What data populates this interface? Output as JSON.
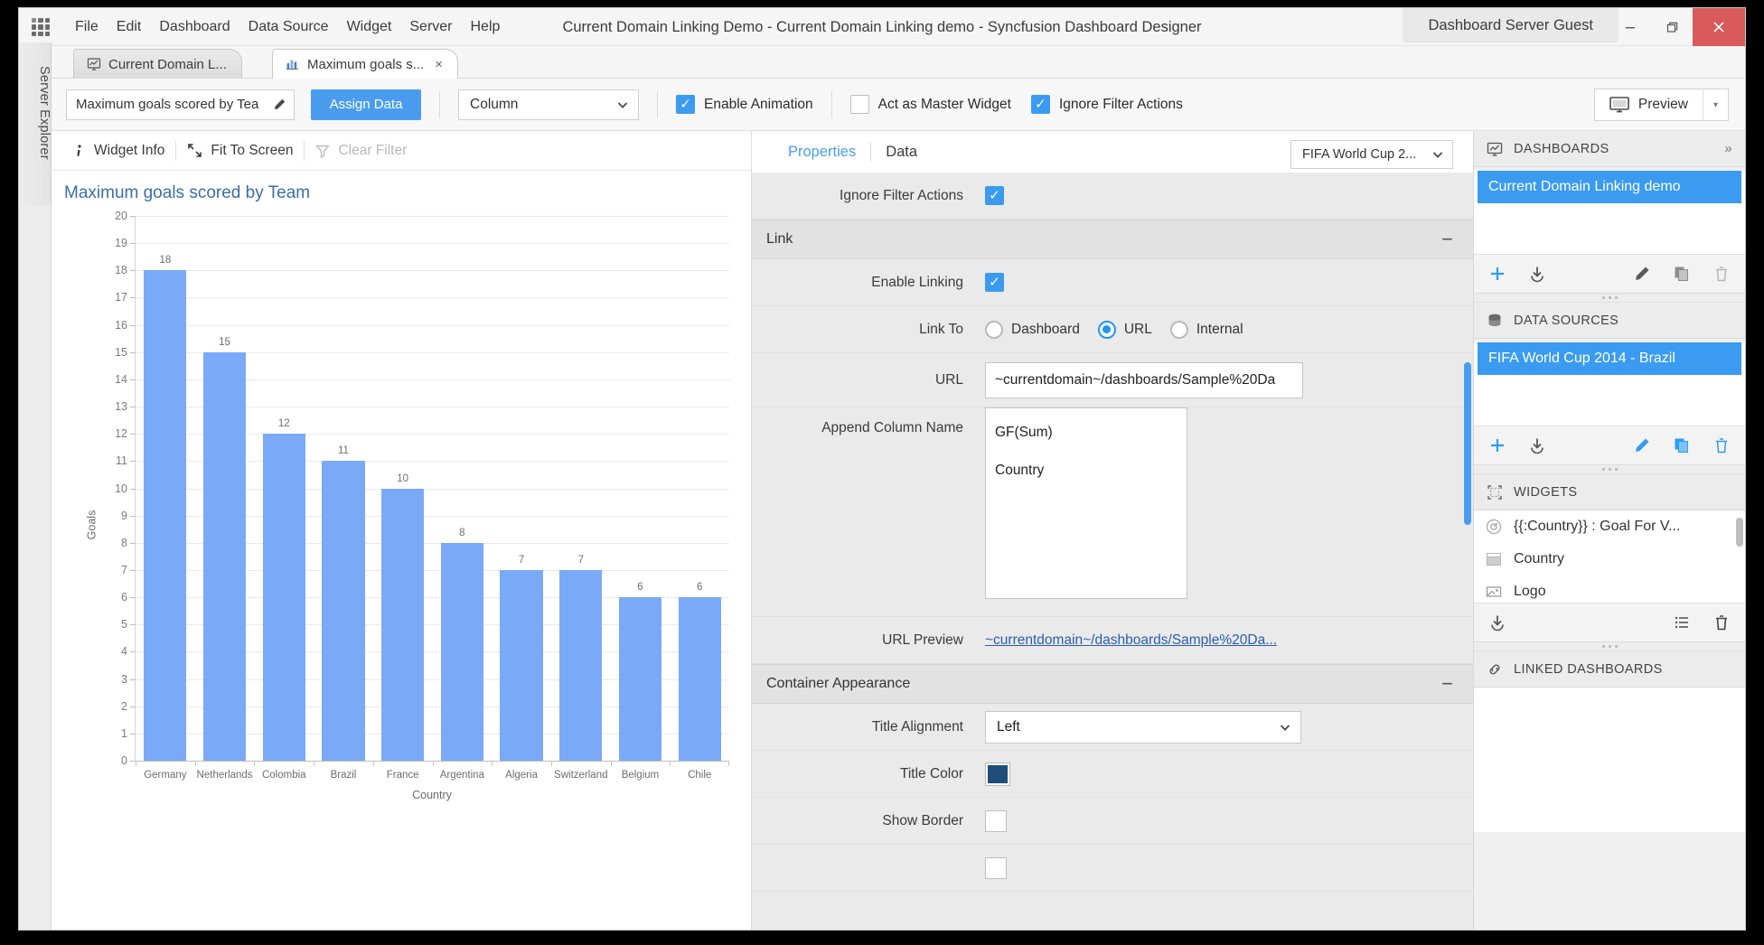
{
  "window": {
    "app_title": "Current Domain Linking Demo - Current Domain Linking demo - Syncfusion Dashboard Designer",
    "user_chip": "Dashboard Server Guest",
    "minimize_icon": "minimize-icon",
    "restore_icon": "restore-icon",
    "close_icon": "close-icon"
  },
  "menu": {
    "items": [
      {
        "label": "File"
      },
      {
        "label": "Edit"
      },
      {
        "label": "Dashboard"
      },
      {
        "label": "Data Source"
      },
      {
        "label": "Widget"
      },
      {
        "label": "Server"
      },
      {
        "label": "Help"
      }
    ]
  },
  "side_rail": {
    "label": "Server Explorer"
  },
  "tabs": [
    {
      "label": "Current Domain L...",
      "icon": "dashboard-tab-icon",
      "active": false,
      "closable": false
    },
    {
      "label": "Maximum goals s...",
      "icon": "chart-tab-icon",
      "active": true,
      "closable": true,
      "close": "×"
    }
  ],
  "toolbar": {
    "widget_title_value": "Maximum goals scored by Tea",
    "widget_title_placeholder": "Widget title",
    "edit_icon": "pencil-icon",
    "assign_data_label": "Assign Data",
    "chart_type_value": "Column",
    "chart_type_caret": "⌄",
    "enable_animation_label": "Enable Animation",
    "enable_animation_checked": true,
    "act_as_master_label": "Act as Master Widget",
    "act_as_master_checked": false,
    "ignore_filter_label": "Ignore Filter Actions",
    "ignore_filter_checked": true,
    "preview_label": "Preview",
    "preview_icon": "monitor-icon",
    "preview_caret": "▾",
    "check_glyph": "✓"
  },
  "chart_toolbar": {
    "widget_info_label": "Widget Info",
    "widget_info_icon": "info-icon",
    "fit_to_screen_label": "Fit To Screen",
    "fit_to_screen_icon": "expand-icon",
    "clear_filter_label": "Clear Filter",
    "clear_filter_icon": "funnel-icon",
    "clear_filter_disabled": true
  },
  "chart_data": {
    "type": "bar",
    "title": "Maximum goals scored by Team",
    "categories": [
      "Germany",
      "Netherlands",
      "Colombia",
      "Brazil",
      "France",
      "Argentina",
      "Algeria",
      "Switzerland",
      "Belgium",
      "Chile"
    ],
    "values": [
      18,
      15,
      12,
      11,
      10,
      8,
      7,
      7,
      6,
      6
    ],
    "xlabel": "Country",
    "ylabel": "Goals",
    "ylim": [
      0,
      20
    ],
    "yticks": [
      0,
      1,
      2,
      3,
      4,
      5,
      6,
      7,
      8,
      9,
      10,
      11,
      12,
      13,
      14,
      15,
      16,
      17,
      18,
      19,
      20
    ],
    "grid": true,
    "legend": "none",
    "series_color": "#7aa9f7",
    "data_labels": true
  },
  "properties": {
    "tab_properties": "Properties",
    "tab_data": "Data",
    "active_tab": "Properties",
    "datasource_value": "FIFA World Cup 2...",
    "datasource_caret": "⌄",
    "rows": {
      "ignore_filter_actions_label": "Ignore Filter Actions",
      "ignore_filter_actions_checked": true,
      "link_section": "Link",
      "link_section_collapse": "−",
      "enable_linking_label": "Enable Linking",
      "enable_linking_checked": true,
      "link_to_label": "Link To",
      "link_to_options": [
        {
          "label": "Dashboard",
          "selected": false
        },
        {
          "label": "URL",
          "selected": true
        },
        {
          "label": "Internal",
          "selected": false
        }
      ],
      "url_label": "URL",
      "url_value": "~currentdomain~/dashboards/Sample%20Da",
      "append_column_label": "Append Column Name",
      "append_columns": [
        "GF(Sum)",
        "Country"
      ],
      "url_preview_label": "URL Preview",
      "url_preview_value": "~currentdomain~/dashboards/Sample%20Da...",
      "container_section": "Container Appearance",
      "container_section_collapse": "−",
      "title_alignment_label": "Title Alignment",
      "title_alignment_value": "Left",
      "title_alignment_caret": "⌄",
      "title_color_label": "Title Color",
      "title_color_value": "#1f4e79",
      "show_border_label": "Show Border",
      "show_border_checked": false
    },
    "highlight_color": "#ee2222",
    "check_glyph": "✓"
  },
  "right_panel": {
    "dashboards": {
      "header": "DASHBOARDS",
      "header_icon": "dashboard-icon",
      "expand_icon": "chevron-right-double-icon",
      "items": [
        {
          "label": "Current Domain Linking demo",
          "selected": true
        }
      ],
      "actions": [
        {
          "name": "add-icon",
          "glyph": "+"
        },
        {
          "name": "download-icon",
          "glyph": "⤓"
        },
        {
          "name": "edit-icon",
          "glyph": "✎"
        },
        {
          "name": "copy-icon",
          "glyph": "⧉"
        },
        {
          "name": "delete-icon",
          "glyph": "Ὕ1"
        }
      ]
    },
    "data_sources": {
      "header": "DATA SOURCES",
      "header_icon": "database-icon",
      "items": [
        {
          "label": "FIFA World Cup 2014 - Brazil",
          "selected": true
        }
      ]
    },
    "widgets": {
      "header": "WIDGETS",
      "header_icon": "widgets-icon",
      "items": [
        {
          "label": "{{:Country}} : Goal For V...",
          "icon": "gauge-icon"
        },
        {
          "label": "Country",
          "icon": "grid-icon"
        },
        {
          "label": "Logo",
          "icon": "image-icon"
        }
      ]
    },
    "linked_dashboards": {
      "header": "LINKED DASHBOARDS",
      "header_icon": "link-icon"
    }
  }
}
